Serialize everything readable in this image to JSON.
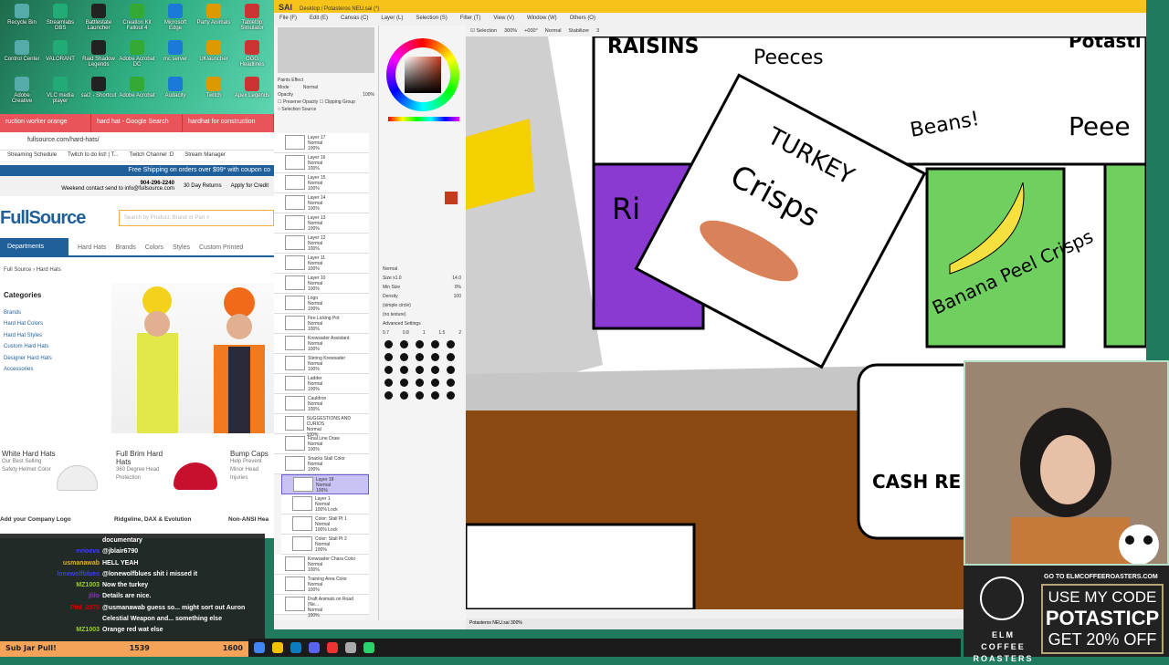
{
  "desktop": {
    "icons": [
      "Recycle Bin",
      "Streamlabs OBS",
      "Battlestate Launcher",
      "Creation Kit Fallout 4",
      "Microsoft Edge",
      "Party Animals",
      "Tabletop Simulator",
      "Control Center",
      "VALORANT",
      "Raid Shadow Legends",
      "Adobe Acrobat DC",
      "mc server",
      "UKlauncher",
      "OGG Headlines",
      "Adobe Creative",
      "VLC media player",
      "sai2 - Shortcut",
      "Adobe Acrobat",
      "Audacity",
      "Twitch",
      "Apex Legends"
    ]
  },
  "browser": {
    "tabs": [
      "ruction worker orange",
      "hard hat - Google Search",
      "hardhat for construction"
    ],
    "url": "fullsource.com/hard-hats/",
    "bookmarks": [
      "Streaming Schedule",
      "Twitch to do list! | T...",
      "Twitch Channel :D",
      "Stream Manager"
    ],
    "banner": "Free Shipping on orders over $99* with coupon co",
    "phone": "904-296-2240",
    "weekend": "Weekend contact send to info@fullsource.com",
    "returns": "30 Day Returns",
    "credit": "Apply for Credit",
    "logo": "FullSource",
    "search_placeholder": "Search by Product, Brand or Part #",
    "nav": {
      "departments": "Departments",
      "items": [
        "Hard Hats",
        "Brands",
        "Colors",
        "Styles",
        "Custom Printed"
      ]
    },
    "breadcrumb": [
      "Full Source",
      "Hard Hats"
    ],
    "categories": {
      "title": "Categories",
      "items": [
        "Brands",
        "Hard Hat Colors",
        "Hard Hat Styles",
        "Custom Hard Hats",
        "Designer Hard Hats",
        "Accessories"
      ]
    },
    "cards": [
      {
        "title": "White Hard Hats",
        "desc": "Our Best Selling Safety Helmet Color"
      },
      {
        "title": "Full Brim Hard Hats",
        "desc": "360 Degree Head Protection"
      },
      {
        "title": "Bump Caps",
        "desc": "Help Prevent Minor Head Injuries"
      }
    ],
    "captions": [
      "Add your Company Logo",
      "Ridgeline, DAX & Evolution",
      "Non-ANSI Hea"
    ]
  },
  "chat": [
    {
      "user": "",
      "msg": "documentary",
      "color": "#fff"
    },
    {
      "user": "evioeva",
      "msg": "@jblair6790",
      "color": "#3b3bff"
    },
    {
      "user": "usmanawab",
      "msg": "HELL YEAH",
      "color": "#e0b030"
    },
    {
      "user": "lonewolfblues",
      "msg": "@lonewolfblues shit i missed it",
      "color": "#3b3bff"
    },
    {
      "user": "MZ1003",
      "msg": "Now the turkey",
      "color": "#9acd32"
    },
    {
      "user": "jlilo",
      "msg": "Details are nice.",
      "color": "#8a2be2"
    },
    {
      "user": "Phil_2070",
      "msg": "@usmanawab guess so... might sort out Auron",
      "color": "#c00"
    },
    {
      "user": "",
      "msg": "Celestial Weapon and... something else",
      "color": "#fff"
    },
    {
      "user": "MZ1003",
      "msg": "Orange red wat else",
      "color": "#9acd32"
    }
  ],
  "subjar": {
    "label": "Sub Jar Pull!",
    "current": "1539",
    "goal": "1600"
  },
  "sai": {
    "app": "SAI",
    "title": "Desktop / Potasteros NEU.sai (*)",
    "menu": [
      "File (F)",
      "Edit (E)",
      "Canvas (C)",
      "Layer (L)",
      "Selection (S)",
      "Filter (T)",
      "View (V)",
      "Window (W)",
      "Others (O)"
    ],
    "toolbar": {
      "selection": "Selection",
      "zoom": "300%",
      "angle": "+000°",
      "mode": "Normal",
      "stabilizer_label": "Stabilizer",
      "stabilizer": "3"
    },
    "layer_props": {
      "paints_effect": "Paints Effect",
      "mode_label": "Mode",
      "mode": "Normal",
      "opacity_label": "Opacity",
      "opacity": "100%",
      "preserve": "Preserve Opacity",
      "clipping": "Clipping Group",
      "selection_source": "Selection Source"
    },
    "layers": [
      {
        "name": "Layer 17",
        "mode": "Normal",
        "op": "100%"
      },
      {
        "name": "Layer 16",
        "mode": "Normal",
        "op": "100%"
      },
      {
        "name": "Layer 15",
        "mode": "Normal",
        "op": "100%"
      },
      {
        "name": "Layer 14",
        "mode": "Normal",
        "op": "100%"
      },
      {
        "name": "Layer 13",
        "mode": "Normal",
        "op": "100%"
      },
      {
        "name": "Layer 12",
        "mode": "Normal",
        "op": "100%"
      },
      {
        "name": "Layer 11",
        "mode": "Normal",
        "op": "100%"
      },
      {
        "name": "Layer 10",
        "mode": "Normal",
        "op": "100%"
      },
      {
        "name": "Logo",
        "mode": "Normal",
        "op": "100%"
      },
      {
        "name": "Fire Licking Pot",
        "mode": "Normal",
        "op": "100%"
      },
      {
        "name": "Krewsader Assistant",
        "mode": "Normal",
        "op": "100%"
      },
      {
        "name": "Stirring Krewsader",
        "mode": "Normal",
        "op": "100%"
      },
      {
        "name": "Ladder",
        "mode": "Normal",
        "op": "100%"
      },
      {
        "name": "Cauldron",
        "mode": "Normal",
        "op": "100%"
      },
      {
        "name": "SUGGESTIONS AND CURIOS",
        "mode": "Normal",
        "op": "100%"
      },
      {
        "name": "Final Line Draw",
        "mode": "Normal",
        "op": "100%"
      },
      {
        "name": "Snacks Stall Color",
        "mode": "Normal",
        "op": "100%"
      },
      {
        "name": "Layer 18",
        "mode": "Normal",
        "op": "100%"
      },
      {
        "name": "Layer 1",
        "mode": "Normal",
        "op": "100% Lock"
      },
      {
        "name": "Color: Stall Pt 1",
        "mode": "Normal",
        "op": "100% Lock"
      },
      {
        "name": "Color: Stall Pt 2",
        "mode": "Normal",
        "op": "100%"
      },
      {
        "name": "Krewsader Chara Color",
        "mode": "Normal",
        "op": "100%"
      },
      {
        "name": "Training Area Color",
        "mode": "Normal",
        "op": "100%"
      },
      {
        "name": "Draft Animals on Road (Ne...",
        "mode": "Normal",
        "op": "100%"
      }
    ],
    "brush": {
      "mode": "Normal",
      "size_label": "Size",
      "size_mult": "x1.0",
      "size": "14.0",
      "min_size_label": "Min Size",
      "min_size": "0%",
      "density_label": "Density",
      "density": "100",
      "shape": "(simple circle)",
      "texture": "(no texture)",
      "advanced": "Advanced Settings",
      "sizes": [
        "0.7",
        "0.8",
        "1",
        "1.5",
        "2"
      ]
    },
    "status": "Potasteros NEU.sai 300%",
    "color": "#c23b1c"
  },
  "canvas_labels": {
    "raisins": "RAISINS",
    "peeces": "Peeces",
    "potash": "Potasti",
    "beans": "Beans!",
    "peel": "Peee",
    "turkey": "TURKEY",
    "crisps": "Crisps",
    "banana": "Banana Peel Crisps",
    "rice": "Ri",
    "cash": "CASH RE"
  },
  "ad": {
    "goto": "GO TO ELMCOFFEEROASTERS.COM",
    "line1": "USE MY CODE",
    "code": "POTASTICP",
    "line3": "GET 20% OFF",
    "brand1": "ELM COFFEE",
    "brand2": "ROASTERS"
  }
}
